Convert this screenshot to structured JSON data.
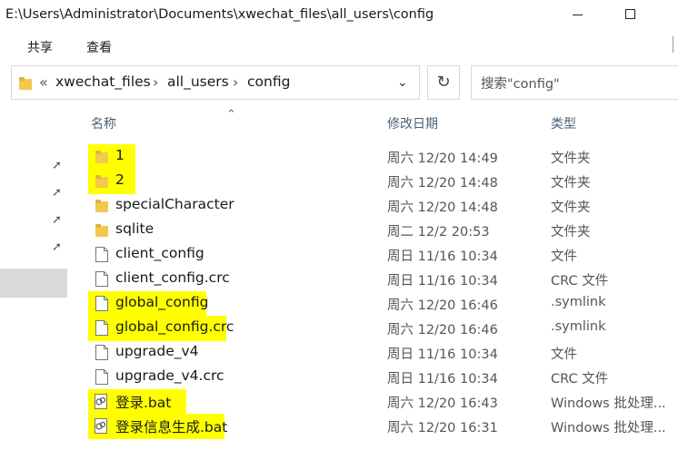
{
  "window": {
    "title": "E:\\Users\\Administrator\\Documents\\xwechat_files\\all_users\\config"
  },
  "ribbon": {
    "tabs": [
      "共享",
      "查看"
    ]
  },
  "address": {
    "overflow": "«",
    "segments": [
      "xwechat_files",
      "all_users",
      "config"
    ],
    "separator": "›"
  },
  "search": {
    "placeholder": "搜索\"config\""
  },
  "columns": {
    "name": "名称",
    "date": "修改日期",
    "type": "类型"
  },
  "files": [
    {
      "name": "1",
      "date": "周六 12/20 14:49",
      "type": "文件夹",
      "icon": "folder-icon",
      "highlighted": true
    },
    {
      "name": "2",
      "date": "周六 12/20 14:48",
      "type": "文件夹",
      "icon": "folder-icon",
      "highlighted": true
    },
    {
      "name": "specialCharacter",
      "date": "周六 12/20 14:48",
      "type": "文件夹",
      "icon": "folder-icon",
      "highlighted": false
    },
    {
      "name": "sqlite",
      "date": "周二 12/2 20:53",
      "type": "文件夹",
      "icon": "folder-icon",
      "highlighted": false
    },
    {
      "name": "client_config",
      "date": "周日 11/16 10:34",
      "type": "文件",
      "icon": "file-icon",
      "highlighted": false
    },
    {
      "name": "client_config.crc",
      "date": "周日 11/16 10:34",
      "type": "CRC 文件",
      "icon": "file-icon",
      "highlighted": false
    },
    {
      "name": "global_config",
      "date": "周六 12/20 16:46",
      "type": ".symlink",
      "icon": "file-icon",
      "highlighted": true
    },
    {
      "name": "global_config.crc",
      "date": "周六 12/20 16:46",
      "type": ".symlink",
      "icon": "file-icon",
      "highlighted": true
    },
    {
      "name": "upgrade_v4",
      "date": "周日 11/16 10:34",
      "type": "文件",
      "icon": "file-icon",
      "highlighted": false
    },
    {
      "name": "upgrade_v4.crc",
      "date": "周日 11/16 10:34",
      "type": "CRC 文件",
      "icon": "file-icon",
      "highlighted": false
    },
    {
      "name": "登录.bat",
      "date": "周六 12/20 16:43",
      "type": "Windows 批处理...",
      "icon": "batch-file-icon",
      "highlighted": true
    },
    {
      "name": "登录信息生成.bat",
      "date": "周六 12/20 16:31",
      "type": "Windows 批处理...",
      "icon": "batch-file-icon",
      "highlighted": true
    }
  ],
  "colors": {
    "highlight": "#ffff00",
    "folder": "#f2c94c",
    "selection": "#d9d9d9",
    "header_text": "#4c607a"
  }
}
